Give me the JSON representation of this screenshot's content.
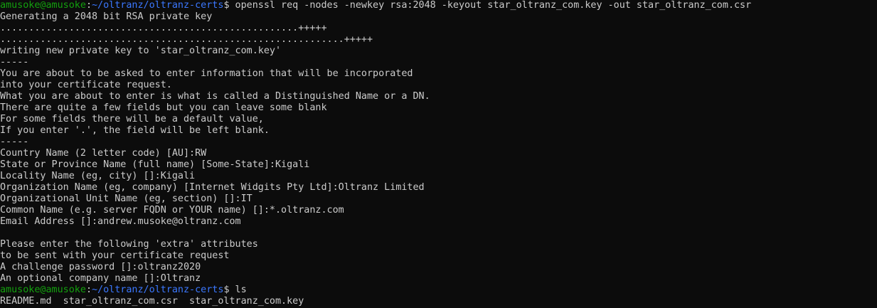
{
  "terminal": {
    "colors": {
      "background": "#0c0c0c",
      "text": "#cccccc",
      "prompt_user": "#13a10e",
      "prompt_path": "#3b78ff"
    },
    "prompt1": {
      "user_host": "amusoke@amusoke",
      "colon": ":",
      "path": "~/oltranz/oltranz-certs",
      "symbol": "$",
      "command": " openssl req -nodes -newkey rsa:2048 -keyout star_oltranz_com.key -out star_oltranz_com.csr"
    },
    "output1": [
      "Generating a 2048 bit RSA private key",
      "....................................................+++++",
      "............................................................+++++",
      "writing new private key to 'star_oltranz_com.key'",
      "-----",
      "You are about to be asked to enter information that will be incorporated",
      "into your certificate request.",
      "What you are about to enter is what is called a Distinguished Name or a DN.",
      "There are quite a few fields but you can leave some blank",
      "For some fields there will be a default value,",
      "If you enter '.', the field will be left blank.",
      "-----",
      "Country Name (2 letter code) [AU]:RW",
      "State or Province Name (full name) [Some-State]:Kigali",
      "Locality Name (eg, city) []:Kigali",
      "Organization Name (eg, company) [Internet Widgits Pty Ltd]:Oltranz Limited",
      "Organizational Unit Name (eg, section) []:IT",
      "Common Name (e.g. server FQDN or YOUR name) []:*.oltranz.com",
      "Email Address []:andrew.musoke@oltranz.com",
      "",
      "Please enter the following 'extra' attributes",
      "to be sent with your certificate request",
      "A challenge password []:oltranz2020",
      "An optional company name []:Oltranz"
    ],
    "prompt2": {
      "user_host": "amusoke@amusoke",
      "colon": ":",
      "path": "~/oltranz/oltranz-certs",
      "symbol": "$",
      "command": " ls"
    },
    "ls_output": "README.md  star_oltranz_com.csr  star_oltranz_com.key"
  }
}
